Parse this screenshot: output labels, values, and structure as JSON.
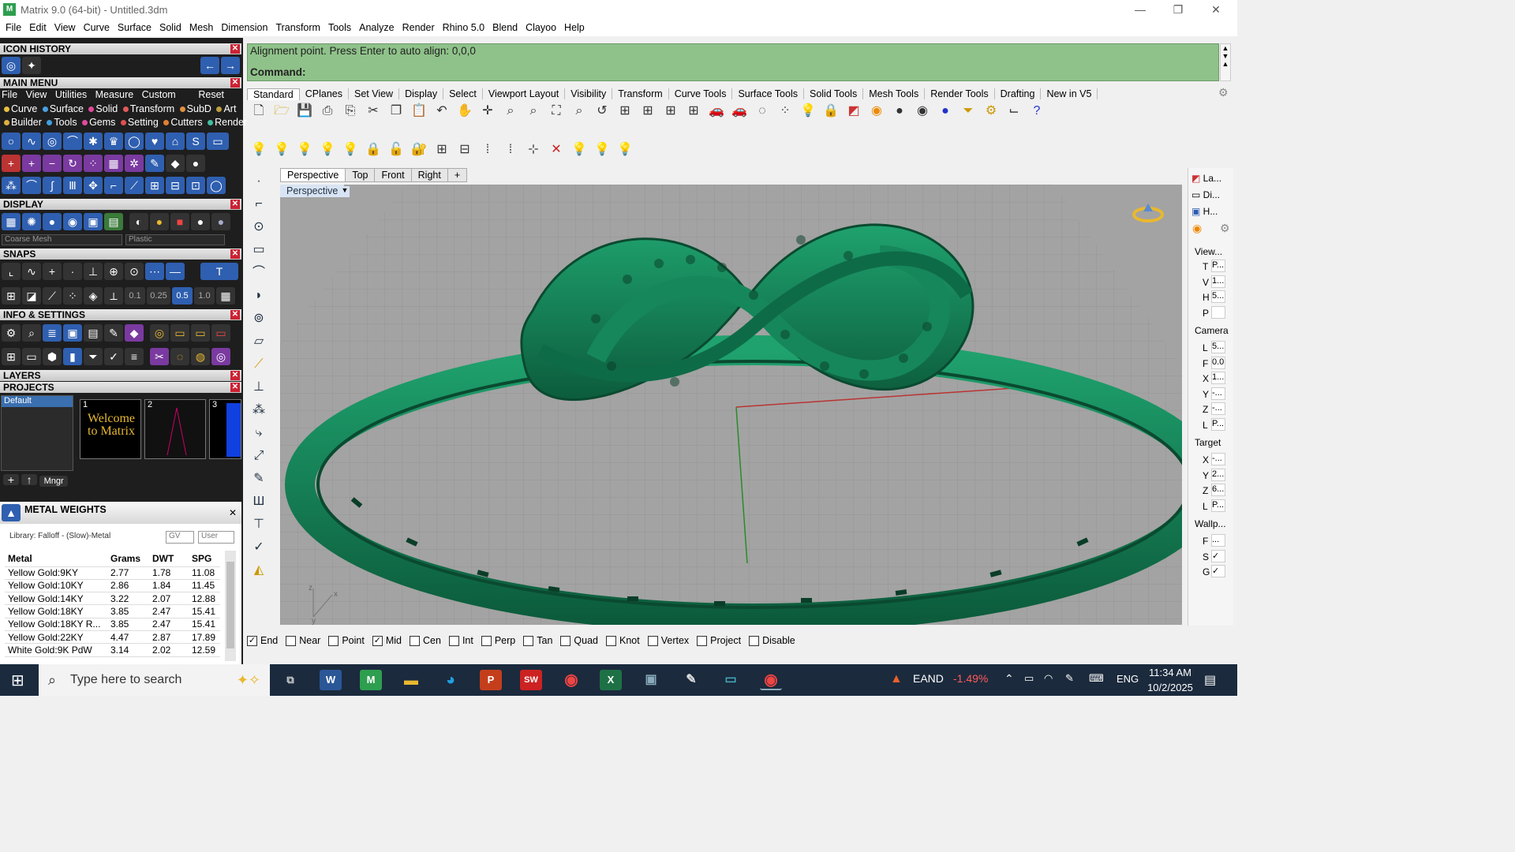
{
  "window": {
    "title": "Matrix 9.0 (64-bit) - Untitled.3dm",
    "minimize": "—",
    "restore": "❐",
    "close": "✕"
  },
  "menu": [
    "File",
    "Edit",
    "View",
    "Curve",
    "Surface",
    "Solid",
    "Mesh",
    "Dimension",
    "Transform",
    "Tools",
    "Analyze",
    "Render",
    "Rhino 5.0",
    "Blend",
    "Clayoo",
    "Help"
  ],
  "left": {
    "icon_history": "ICON HISTORY",
    "main_menu": "MAIN MENU",
    "main_menu_items": [
      "File",
      "View",
      "Utilities",
      "Measure",
      "Custom"
    ],
    "reset": "Reset",
    "categories_row1": [
      "Curve",
      "Surface",
      "Solid",
      "Transform",
      "SubD",
      "Art"
    ],
    "categories_row2": [
      "Builder",
      "Tools",
      "Gems",
      "Setting",
      "Cutters",
      "Render"
    ],
    "display": "DISPLAY",
    "display_mesh": "Coarse Mesh",
    "display_material": "Plastic",
    "snaps": "SNAPS",
    "snap_values": [
      "0.1",
      "0.25",
      "0.5",
      "1.0"
    ],
    "info_settings": "INFO & SETTINGS",
    "layers": "LAYERS",
    "projects": "PROJECTS",
    "project_default": "Default",
    "project_thumbs": [
      "1",
      "2",
      "3"
    ],
    "welcome_text": "Welcome to Matrix",
    "mngr": "Mngr"
  },
  "metal_weights": {
    "title": "METAL WEIGHTS",
    "library": "Library: Falloff - (Slow)-Metal",
    "gv": "GV",
    "user": "User",
    "headers": [
      "Metal",
      "Grams",
      "DWT",
      "SPG"
    ],
    "rows": [
      [
        "Yellow Gold:9KY",
        "2.77",
        "1.78",
        "11.08"
      ],
      [
        "Yellow Gold:10KY",
        "2.86",
        "1.84",
        "11.45"
      ],
      [
        "Yellow Gold:14KY",
        "3.22",
        "2.07",
        "12.88"
      ],
      [
        "Yellow Gold:18KY",
        "3.85",
        "2.47",
        "15.41"
      ],
      [
        "Yellow Gold:18KY R...",
        "3.85",
        "2.47",
        "15.41"
      ],
      [
        "Yellow Gold:22KY",
        "4.47",
        "2.87",
        "17.89"
      ],
      [
        "White Gold:9K PdW",
        "3.14",
        "2.02",
        "12.59"
      ]
    ]
  },
  "command": {
    "line1": "Alignment point. Press Enter to auto align: 0,0,0",
    "line2": "Command:"
  },
  "toolbar_tabs": [
    "Standard",
    "CPlanes",
    "Set View",
    "Display",
    "Select",
    "Viewport Layout",
    "Visibility",
    "Transform",
    "Curve Tools",
    "Surface Tools",
    "Solid Tools",
    "Mesh Tools",
    "Render Tools",
    "Drafting",
    "New in V5"
  ],
  "viewport_tabs": [
    "Perspective",
    "Top",
    "Front",
    "Right",
    "+"
  ],
  "viewport_label": "Perspective",
  "right_panel": {
    "tabs": [
      "La...",
      "Di...",
      "H..."
    ],
    "view": "View...",
    "view_rows": [
      [
        "T",
        "P..."
      ],
      [
        "V",
        "1..."
      ],
      [
        "H",
        "5..."
      ],
      [
        "P",
        ""
      ]
    ],
    "camera": "Camera",
    "camera_rows": [
      [
        "L",
        "5..."
      ],
      [
        "F",
        "0.0"
      ],
      [
        "X",
        "1..."
      ],
      [
        "Y",
        "-..."
      ],
      [
        "Z",
        "-..."
      ],
      [
        "L",
        "P..."
      ]
    ],
    "target": "Target",
    "target_rows": [
      [
        "X",
        "-..."
      ],
      [
        "Y",
        "2..."
      ],
      [
        "Z",
        "6..."
      ],
      [
        "L",
        "P..."
      ]
    ],
    "wallpaper": "Wallp...",
    "wall_rows": [
      [
        "F",
        "..."
      ],
      [
        "S",
        "✓"
      ],
      [
        "G",
        "✓"
      ]
    ]
  },
  "osnaps": [
    {
      "label": "End",
      "checked": true
    },
    {
      "label": "Near",
      "checked": false
    },
    {
      "label": "Point",
      "checked": false
    },
    {
      "label": "Mid",
      "checked": true
    },
    {
      "label": "Cen",
      "checked": false
    },
    {
      "label": "Int",
      "checked": false
    },
    {
      "label": "Perp",
      "checked": false
    },
    {
      "label": "Tan",
      "checked": false
    },
    {
      "label": "Quad",
      "checked": false
    },
    {
      "label": "Knot",
      "checked": false
    },
    {
      "label": "Vertex",
      "checked": false
    },
    {
      "label": "Project",
      "checked": false
    },
    {
      "label": "Disable",
      "checked": false
    }
  ],
  "taskbar": {
    "search_placeholder": "Type here to search",
    "stock_name": "EAND",
    "stock_change": "-1.49%",
    "lang": "ENG",
    "time": "11:34 AM",
    "date": "10/2/2025"
  },
  "colors": {
    "accent_green": "#1a8a5a",
    "command_bg": "#8fc28a",
    "stock_red": "#ff5b5b"
  }
}
